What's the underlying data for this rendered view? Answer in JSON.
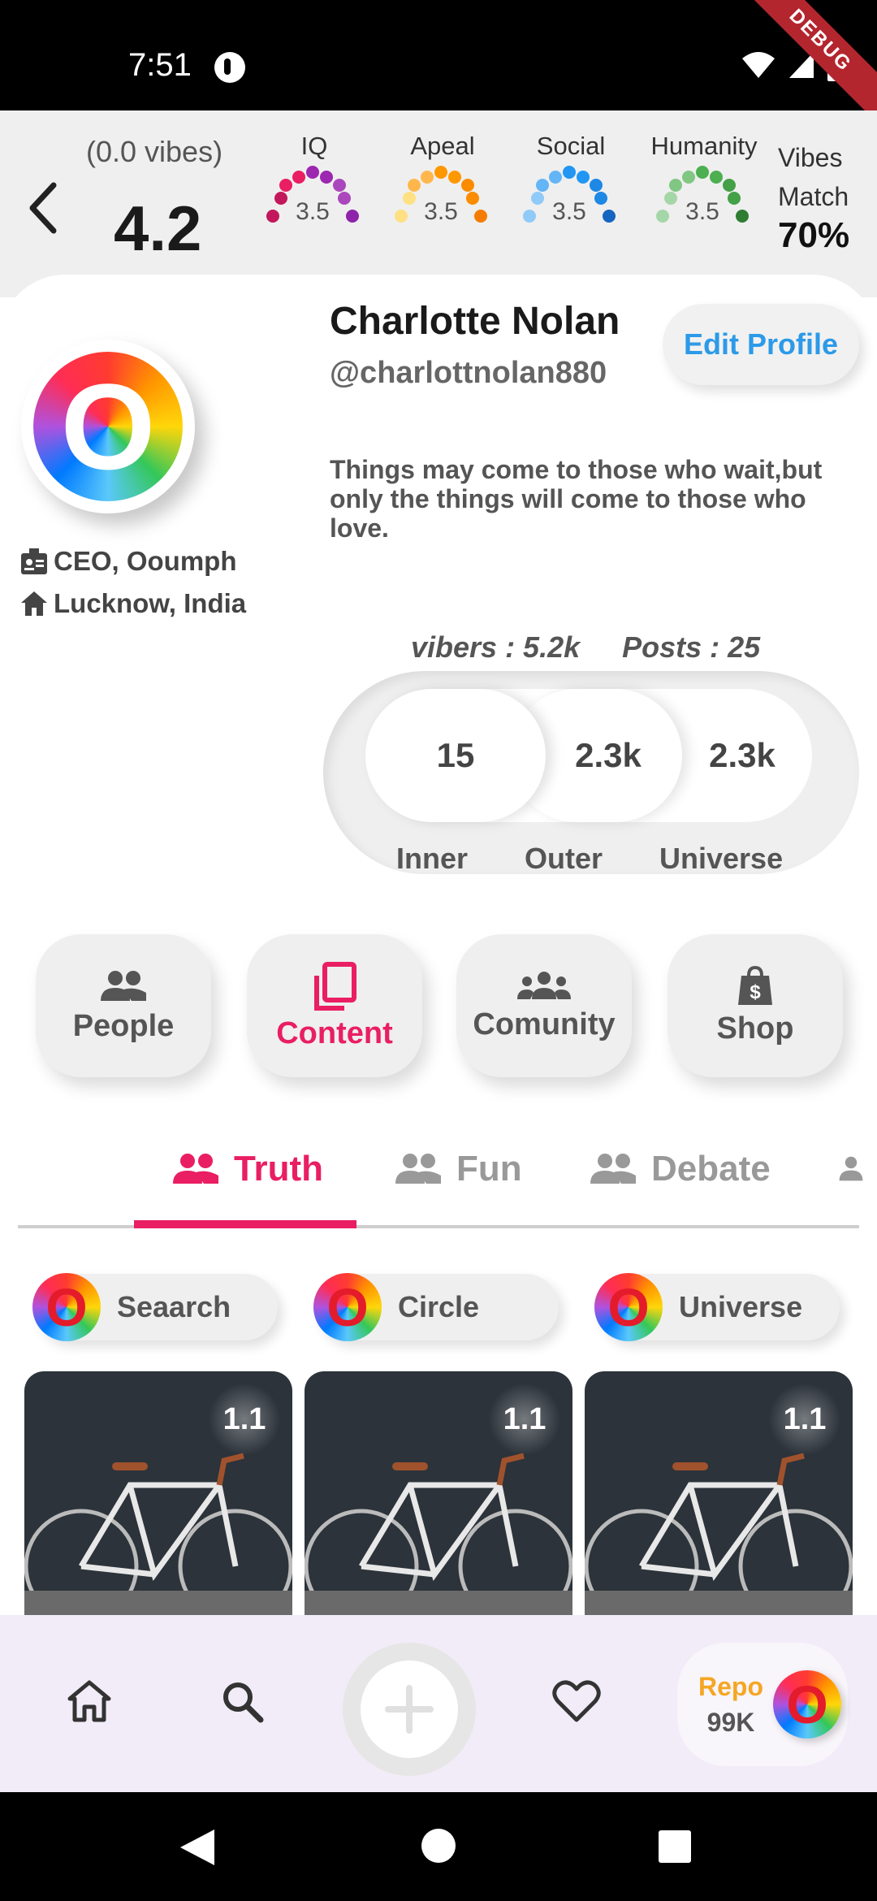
{
  "status_bar": {
    "time": "7:51",
    "debug_label": "DEBUG"
  },
  "header": {
    "vibes_label": "(0.0 vibes)",
    "vibes_score": "4.2",
    "metrics": [
      {
        "label": "IQ",
        "value": "3.5",
        "colors": [
          "#c2185b",
          "#e91e63",
          "#9c27b0",
          "#ab47bc",
          "#8e24aa"
        ]
      },
      {
        "label": "Apeal",
        "value": "3.5",
        "colors": [
          "#ffe082",
          "#ffb74d",
          "#ff9800",
          "#fb8c00",
          "#f57c00"
        ]
      },
      {
        "label": "Social",
        "value": "3.5",
        "colors": [
          "#90caf9",
          "#64b5f6",
          "#2196f3",
          "#1e88e5",
          "#1565c0"
        ]
      },
      {
        "label": "Humanity",
        "value": "3.5",
        "colors": [
          "#a5d6a7",
          "#81c784",
          "#4caf50",
          "#43a047",
          "#2e7d32"
        ]
      }
    ],
    "match_label_1": "Vibes",
    "match_label_2": "Match",
    "match_value": "70%"
  },
  "profile": {
    "name": "Charlotte Nolan",
    "handle": "@charlottnolan880",
    "edit_label": "Edit Profile",
    "bio": "Things may come to those who wait,but only the things will come to those who love.",
    "job": "CEO, Ooumph",
    "location": "Lucknow, India",
    "vibers": "vibers : 5.2k",
    "posts": "Posts : 25",
    "circles": [
      {
        "value": "15",
        "label": "Inner"
      },
      {
        "value": "2.3k",
        "label": "Outer"
      },
      {
        "value": "2.3k",
        "label": "Universe"
      }
    ],
    "logo_letter": "O"
  },
  "categories": [
    {
      "label": "People",
      "icon": "people-icon"
    },
    {
      "label": "Content",
      "icon": "copy-icon",
      "active": true
    },
    {
      "label": "Comunity",
      "icon": "groups-icon"
    },
    {
      "label": "Shop",
      "icon": "shopping-bag-icon"
    }
  ],
  "tabs": [
    {
      "label": "Truth",
      "active": true
    },
    {
      "label": "Fun"
    },
    {
      "label": "Debate"
    }
  ],
  "chips": [
    {
      "label": "Seaarch"
    },
    {
      "label": "Circle"
    },
    {
      "label": "Universe"
    }
  ],
  "posts": [
    {
      "score": "1.1"
    },
    {
      "score": "1.1"
    },
    {
      "score": "1.1"
    }
  ],
  "bottom_nav": {
    "repo_label": "Repo",
    "repo_value": "99K"
  },
  "colors": {
    "accent": "#e91e63",
    "link": "#2c9ae8",
    "repo": "#f5a623"
  }
}
